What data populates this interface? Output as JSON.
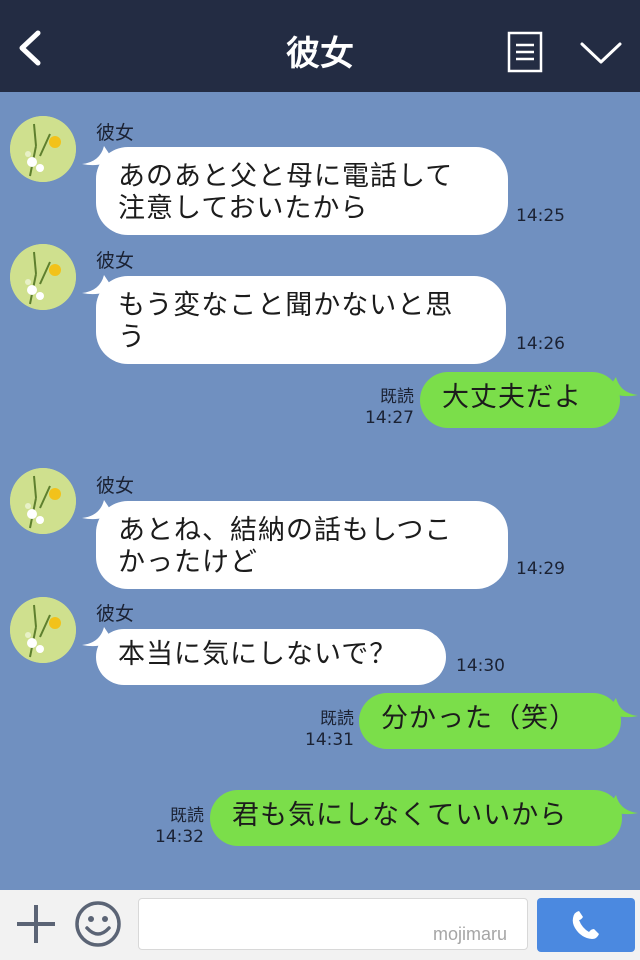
{
  "header": {
    "title": "彼女",
    "icons": [
      "back-icon",
      "menu-icon",
      "chevron-down-icon"
    ]
  },
  "colors": {
    "header_bg": "#232c43",
    "chat_bg": "#7090c0",
    "incoming_bubble": "#ffffff",
    "outgoing_bubble": "#7bde4a",
    "call_button": "#4b89e0"
  },
  "messages": [
    {
      "direction": "in",
      "sender": "彼女",
      "lines": [
        "あのあと父と母に電話して",
        "注意しておいたから"
      ],
      "time": "14:25"
    },
    {
      "direction": "in",
      "sender": "彼女",
      "lines": [
        "もう変なこと聞かないと思",
        "う"
      ],
      "time": "14:26"
    },
    {
      "direction": "out",
      "read": "既読",
      "text": "大丈夫だよ",
      "time": "14:27"
    },
    {
      "direction": "in",
      "sender": "彼女",
      "lines": [
        "あとね、結納の話もしつこ",
        "かったけど"
      ],
      "time": "14:29"
    },
    {
      "direction": "in",
      "sender": "彼女",
      "lines": [
        "本当に気にしないで？"
      ],
      "time": "14:30"
    },
    {
      "direction": "out",
      "read": "既読",
      "text": "分かった（笑）",
      "time": "14:31"
    },
    {
      "direction": "out",
      "read": "既読",
      "text": "君も気にしなくていいから",
      "time": "14:32"
    }
  ],
  "input_bar": {
    "icons": [
      "plus-icon",
      "emoji-icon",
      "phone-icon"
    ],
    "watermark": "mojimaru"
  }
}
